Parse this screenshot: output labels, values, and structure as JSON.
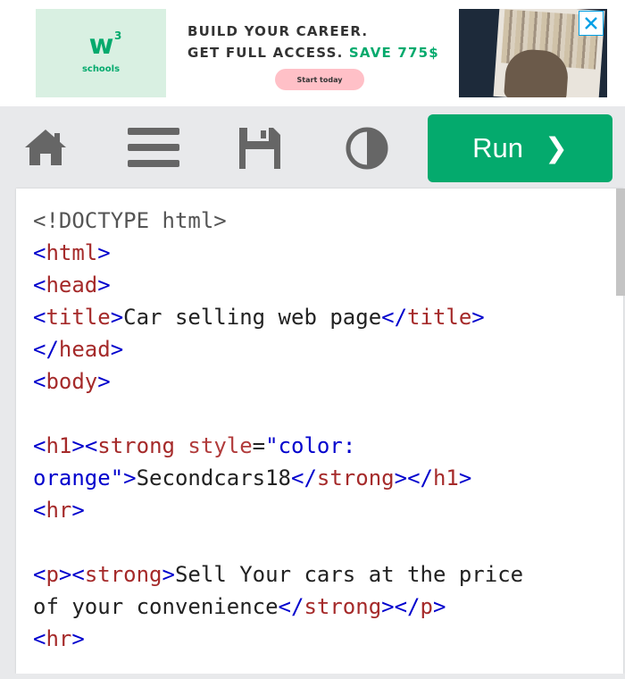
{
  "ad": {
    "logo_mark": "w",
    "logo_sup": "3",
    "logo_sub": "schools",
    "headline_line1": "BUILD YOUR CAREER.",
    "headline_line2_prefix": "GET FULL ACCESS. ",
    "headline_line2_save": "SAVE 775$",
    "cta_label": "Start today",
    "close_icon": "close-icon"
  },
  "toolbar": {
    "icons": [
      "home-icon",
      "menu-icon",
      "save-icon",
      "theme-toggle-icon"
    ],
    "run_label": "Run",
    "run_arrow": "❯"
  },
  "editor": {
    "lines": [
      "<!DOCTYPE html>",
      "<html>",
      "<head>",
      "<title>Car selling web page</title>",
      "</head>",
      "<body>",
      "",
      "<h1><strong style=\"color:",
      "orange\">Secondcars18</strong></h1>",
      "<hr>",
      "",
      "<p><strong>Sell Your cars at the price",
      "of your convenience</strong></p>",
      "<hr>"
    ]
  },
  "colors": {
    "accent": "#04aa6d",
    "tag_bracket": "#0000cd",
    "tag_name": "#a52a2a",
    "cta_pink": "#ffc0c7",
    "close_blue": "#00a0e6"
  }
}
